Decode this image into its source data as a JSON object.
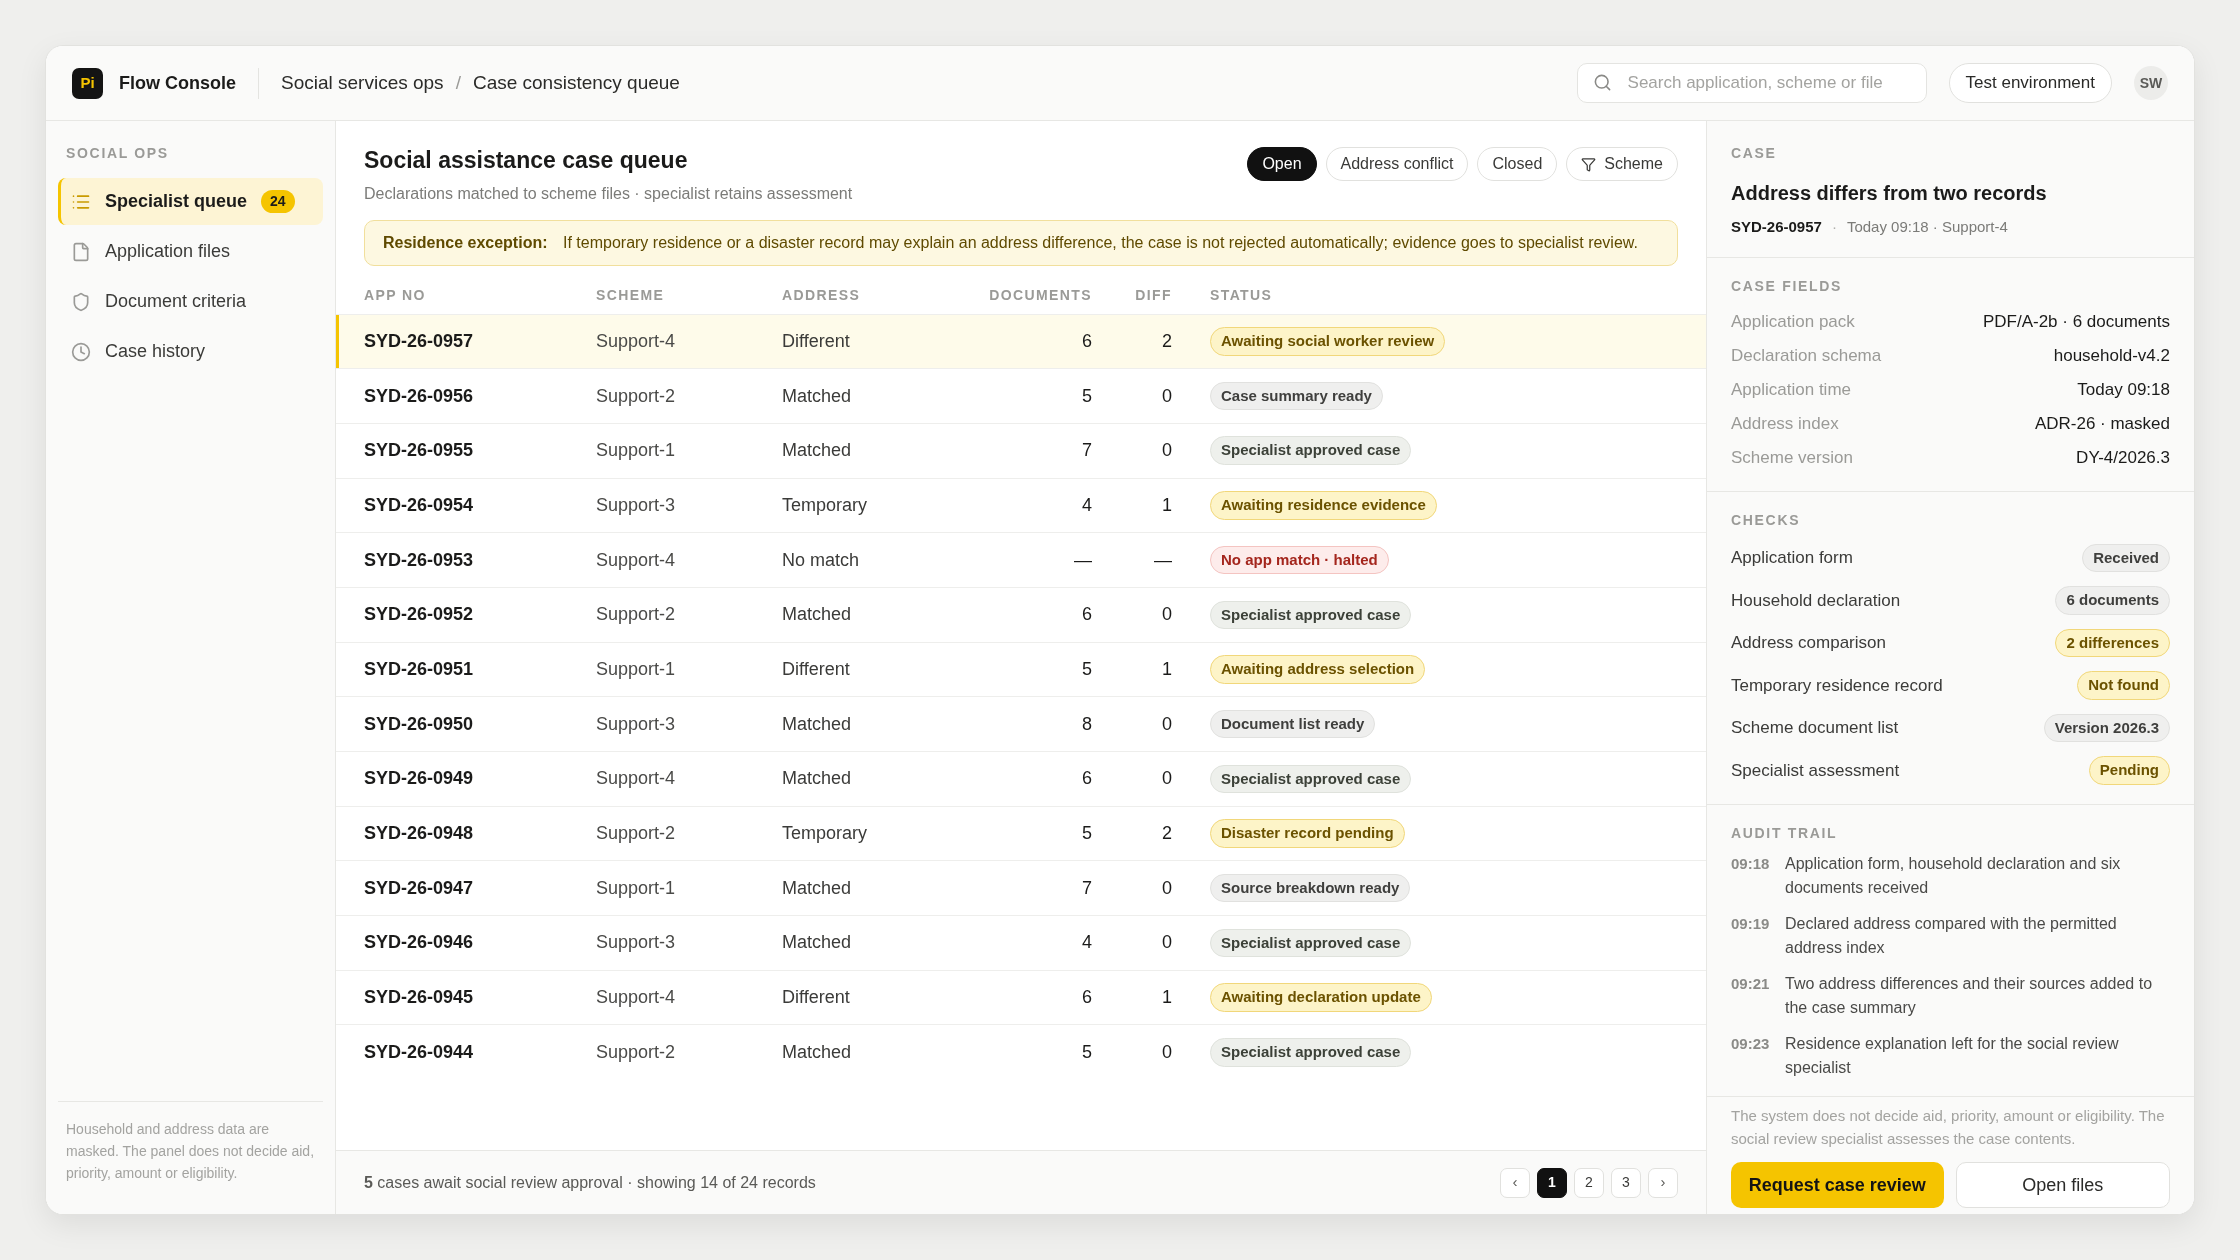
{
  "brand": {
    "logo": "Pi",
    "name": "Flow Console"
  },
  "breadcrumb": [
    "Social services ops",
    "Case consistency queue"
  ],
  "breadcrumb_separator": "/",
  "search": {
    "placeholder": "Search application, scheme or file"
  },
  "environment": "Test environment",
  "avatar": "SW",
  "sidebar": {
    "section": "SOCIAL OPS",
    "items": [
      {
        "label": "Specialist queue",
        "badge": "24",
        "selected": true
      },
      {
        "label": "Application files",
        "selected": false
      },
      {
        "label": "Document criteria",
        "selected": false
      },
      {
        "label": "Case history",
        "selected": false
      }
    ],
    "note": "Household and address data are masked. The panel does not decide aid, priority, amount or eligibility."
  },
  "queue": {
    "title": "Social assistance case queue",
    "subtitle": "Declarations matched to scheme files · specialist retains assessment",
    "filters": [
      {
        "label": "Open",
        "selected": true
      },
      {
        "label": "Address conflict",
        "selected": false
      },
      {
        "label": "Closed",
        "selected": false
      },
      {
        "label": "Scheme",
        "kind": "filter",
        "selected": false
      }
    ],
    "notice": {
      "label": "Residence exception:",
      "text": "If temporary residence or a disaster record may explain an address difference, the case is not rejected automatically; evidence goes to specialist review."
    }
  },
  "table": {
    "columns": [
      "APP NO",
      "SCHEME",
      "ADDRESS",
      "DOCUMENTS",
      "DIFF",
      "STATUS"
    ],
    "rows": [
      {
        "app_no": "SYD-26-0957",
        "scheme": "Support-4",
        "address": "Different",
        "documents": "6",
        "diff": "2",
        "status": "Awaiting social worker review",
        "kind": "warning",
        "selected": true
      },
      {
        "app_no": "SYD-26-0956",
        "scheme": "Support-2",
        "address": "Matched",
        "documents": "5",
        "diff": "0",
        "status": "Case summary ready",
        "kind": "neutral",
        "selected": false
      },
      {
        "app_no": "SYD-26-0955",
        "scheme": "Support-1",
        "address": "Matched",
        "documents": "7",
        "diff": "0",
        "status": "Specialist approved case",
        "kind": "success",
        "selected": false
      },
      {
        "app_no": "SYD-26-0954",
        "scheme": "Support-3",
        "address": "Temporary",
        "documents": "4",
        "diff": "1",
        "status": "Awaiting residence evidence",
        "kind": "warning",
        "selected": false
      },
      {
        "app_no": "SYD-26-0953",
        "scheme": "Support-4",
        "address": "No match",
        "documents": "—",
        "diff": "—",
        "status": "No app match · halted",
        "kind": "danger",
        "selected": false
      },
      {
        "app_no": "SYD-26-0952",
        "scheme": "Support-2",
        "address": "Matched",
        "documents": "6",
        "diff": "0",
        "status": "Specialist approved case",
        "kind": "success",
        "selected": false
      },
      {
        "app_no": "SYD-26-0951",
        "scheme": "Support-1",
        "address": "Different",
        "documents": "5",
        "diff": "1",
        "status": "Awaiting address selection",
        "kind": "warning",
        "selected": false
      },
      {
        "app_no": "SYD-26-0950",
        "scheme": "Support-3",
        "address": "Matched",
        "documents": "8",
        "diff": "0",
        "status": "Document list ready",
        "kind": "neutral",
        "selected": false
      },
      {
        "app_no": "SYD-26-0949",
        "scheme": "Support-4",
        "address": "Matched",
        "documents": "6",
        "diff": "0",
        "status": "Specialist approved case",
        "kind": "success",
        "selected": false
      },
      {
        "app_no": "SYD-26-0948",
        "scheme": "Support-2",
        "address": "Temporary",
        "documents": "5",
        "diff": "2",
        "status": "Disaster record pending",
        "kind": "warning",
        "selected": false
      },
      {
        "app_no": "SYD-26-0947",
        "scheme": "Support-1",
        "address": "Matched",
        "documents": "7",
        "diff": "0",
        "status": "Source breakdown ready",
        "kind": "neutral",
        "selected": false
      },
      {
        "app_no": "SYD-26-0946",
        "scheme": "Support-3",
        "address": "Matched",
        "documents": "4",
        "diff": "0",
        "status": "Specialist approved case",
        "kind": "success",
        "selected": false
      },
      {
        "app_no": "SYD-26-0945",
        "scheme": "Support-4",
        "address": "Different",
        "documents": "6",
        "diff": "1",
        "status": "Awaiting declaration update",
        "kind": "warning",
        "selected": false
      },
      {
        "app_no": "SYD-26-0944",
        "scheme": "Support-2",
        "address": "Matched",
        "documents": "5",
        "diff": "0",
        "status": "Specialist approved case",
        "kind": "success",
        "selected": false
      }
    ]
  },
  "footer": {
    "summary": "**5** cases await social review approval · showing 14 of 24 records",
    "prev": "‹",
    "next": "›",
    "pages": [
      {
        "label": "1",
        "selected": true
      },
      {
        "label": "2",
        "selected": false
      },
      {
        "label": "3",
        "selected": false
      }
    ]
  },
  "case": {
    "section": "CASE",
    "title": "Address differs from two records",
    "app_no": "SYD-26-0957",
    "separator": "·",
    "meta": "Today 09:18 · Support-4"
  },
  "case_fields": {
    "section": "CASE FIELDS",
    "items": [
      {
        "label": "Application pack",
        "value": "PDF/A-2b · 6 documents"
      },
      {
        "label": "Declaration schema",
        "value": "household-v4.2"
      },
      {
        "label": "Application time",
        "value": "Today 09:18"
      },
      {
        "label": "Address index",
        "value": "ADR-26 · masked"
      },
      {
        "label": "Scheme version",
        "value": "DY-4/2026.3"
      }
    ]
  },
  "checks": {
    "section": "CHECKS",
    "items": [
      {
        "label": "Application form",
        "value": "Received",
        "kind": "neutral"
      },
      {
        "label": "Household declaration",
        "value": "6 documents",
        "kind": "neutral"
      },
      {
        "label": "Address comparison",
        "value": "2 differences",
        "kind": "warning"
      },
      {
        "label": "Temporary residence record",
        "value": "Not found",
        "kind": "warning"
      },
      {
        "label": "Scheme document list",
        "value": "Version 2026.3",
        "kind": "neutral"
      },
      {
        "label": "Specialist assessment",
        "value": "Pending",
        "kind": "warning"
      }
    ]
  },
  "audit": {
    "section": "AUDIT TRAIL",
    "items": [
      {
        "time": "09:18",
        "text": "Application form, household declaration and six documents received"
      },
      {
        "time": "09:19",
        "text": "Declared address compared with the permitted address index"
      },
      {
        "time": "09:21",
        "text": "Two address differences and their sources added to the case summary"
      },
      {
        "time": "09:23",
        "text": "Residence explanation left for the social review specialist"
      }
    ]
  },
  "disclaimer": "The system does not decide aid, priority, amount or eligibility. The social review specialist assesses the case contents.",
  "actions": [
    {
      "label": "Request case review",
      "kind": "primary"
    },
    {
      "label": "Open files",
      "kind": "secondary"
    }
  ]
}
